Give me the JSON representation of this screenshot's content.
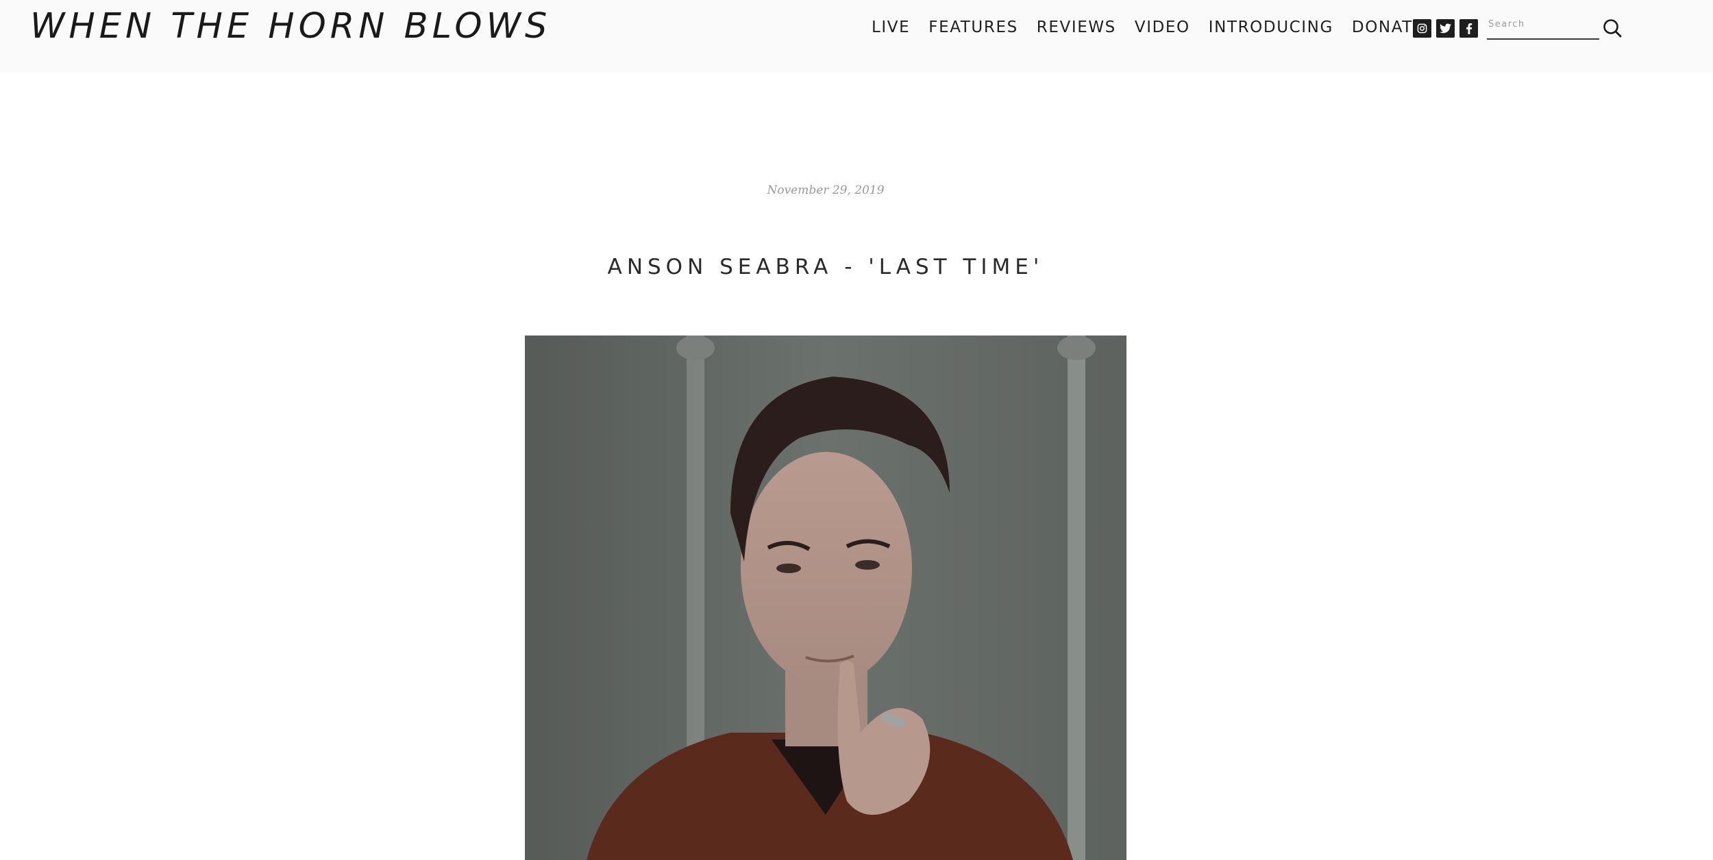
{
  "site": {
    "logo": "WHEN THE HORN BLOWS"
  },
  "nav": {
    "items": [
      {
        "label": "LIVE"
      },
      {
        "label": "FEATURES"
      },
      {
        "label": "REVIEWS"
      },
      {
        "label": "VIDEO"
      },
      {
        "label": "INTRODUCING"
      },
      {
        "label": "DONATE"
      }
    ]
  },
  "social": {
    "icons": [
      "instagram-icon",
      "twitter-icon",
      "facebook-icon"
    ]
  },
  "search": {
    "placeholder": "Search",
    "icon": "search-icon"
  },
  "article": {
    "date": "November 29, 2019",
    "title": "ANSON SEABRA - 'LAST TIME'",
    "image": "portrait-photo"
  },
  "colors": {
    "header_bg": "#fafafa",
    "text": "#1f1f1f",
    "date_text": "#9a9a9a",
    "icon_bg": "#1e1e1e"
  }
}
